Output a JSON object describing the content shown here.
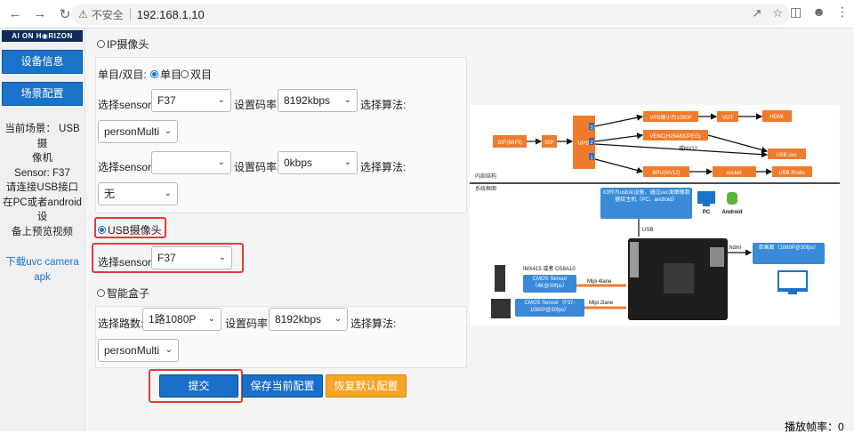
{
  "browser": {
    "insecure_label": "不安全",
    "url": "192.168.1.10"
  },
  "sidebar": {
    "logo": "AI ON H◉RIZON",
    "device_info_btn": "设备信息",
    "scene_config_btn": "场景配置",
    "scene_info": [
      "当前场景：  USB摄",
      "像机",
      "Sensor: F37",
      "请连接USB接口",
      "在PC或者android设",
      "备上预览视频"
    ],
    "download_link": [
      "下载uvc camera",
      "apk"
    ]
  },
  "form": {
    "ip_camera_label": "IP摄像头",
    "mono_stereo_label": "单目/双目:",
    "mono_label": "单目",
    "stereo_label": "双目",
    "sensor_label": "选择sensor:",
    "bitrate_label": "设置码率:",
    "algo_label": "选择算法:",
    "ip_sensor1": "F37",
    "ip_bitrate1": "8192kbps",
    "ip_algo1": "personMulti",
    "ip_sensor2": "",
    "ip_bitrate2": "0kbps",
    "ip_algo2": "无",
    "usb_camera_label": "USB摄像头",
    "usb_sensor_label": "选择sensor:",
    "usb_sensor": "F37",
    "smart_box_label": "智能盒子",
    "channels_label": "选择路数:",
    "box_channels": "1路1080P",
    "box_bitrate": "8192kbps",
    "box_algo": "personMulti"
  },
  "buttons": {
    "submit": "提交",
    "save": "保存当前配置",
    "restore": "恢复默认配置"
  },
  "diagram": {
    "sif": "SIF(MIPI)",
    "isp": "ISP",
    "vps": "VPS",
    "vps_ports": [
      "3",
      "2",
      "1"
    ],
    "vps_scale": "VPS缩小为1080P",
    "vot": "VOT",
    "hdmi": "HDMI",
    "venc": "VENC(H264/MJPEG)",
    "nv12": "或NV12",
    "usb_uvc": "USB uvc",
    "bpu": "BPU(NV12)",
    "socket": "socket",
    "usb_rndis": "USB Rndis",
    "internal_label": "内部结构",
    "system_label": "系统框图",
    "x3_note": "X3作为usb从设备，通过uvc发图像数据给主机（PC、android）",
    "pc_label": "PC",
    "android_label": "Android",
    "usb_label": "USB",
    "hdmi_label": "hdmi",
    "monitor_label": "单画面（1080P@30fps）",
    "sensor_model": "IMX415 或者 OS8A10",
    "cmos1": "CMOS Sensor（4K@30fps）",
    "mipi4": "Mipi 4lane",
    "cmos2": "CMOS Sensor（F37-1080P@30fps）",
    "mipi2": "Mipi 2lane"
  },
  "status": {
    "fps": "播放帧率：0"
  }
}
